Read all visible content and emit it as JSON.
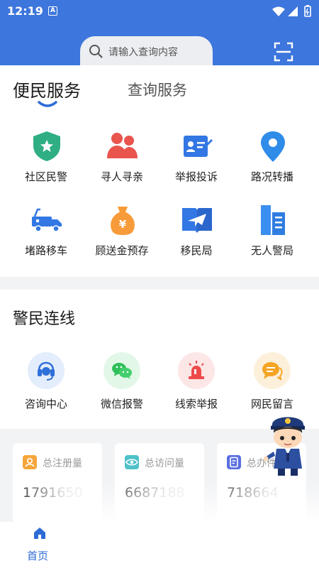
{
  "status": {
    "time": "12:19",
    "notif_letter": "A"
  },
  "search": {
    "placeholder": "请输入查询内容"
  },
  "tabs": [
    {
      "label": "便民服务",
      "active": true
    },
    {
      "label": "查询服务",
      "active": false
    }
  ],
  "services": [
    {
      "label": "社区民警",
      "icon": "shield-star-icon"
    },
    {
      "label": "寻人寻亲",
      "icon": "people-icon"
    },
    {
      "label": "举报投诉",
      "icon": "id-card-pen-icon"
    },
    {
      "label": "路况转播",
      "icon": "location-pin-icon"
    },
    {
      "label": "堵路移车",
      "icon": "tow-truck-icon"
    },
    {
      "label": "顾送金预存",
      "icon": "money-bag-icon"
    },
    {
      "label": "移民局",
      "icon": "book-plane-icon"
    },
    {
      "label": "无人警局",
      "icon": "buildings-icon"
    }
  ],
  "contact": {
    "title": "警民连线",
    "items": [
      {
        "label": "咨询中心",
        "icon": "headset-icon"
      },
      {
        "label": "微信报警",
        "icon": "wechat-icon"
      },
      {
        "label": "线索举报",
        "icon": "alarm-light-icon"
      },
      {
        "label": "网民留言",
        "icon": "chat-bubble-icon"
      }
    ]
  },
  "stats": [
    {
      "label": "总注册量",
      "value": "1791650",
      "color": "#f6a63c"
    },
    {
      "label": "总访问量",
      "value": "6687188",
      "color": "#4fc1c9"
    },
    {
      "label": "总办件",
      "value": "718664",
      "color": "#5a6fe0"
    }
  ],
  "nav": {
    "home_label": "首页"
  },
  "colors": {
    "header": "#3d76dc",
    "accent": "#2d6bd6"
  }
}
